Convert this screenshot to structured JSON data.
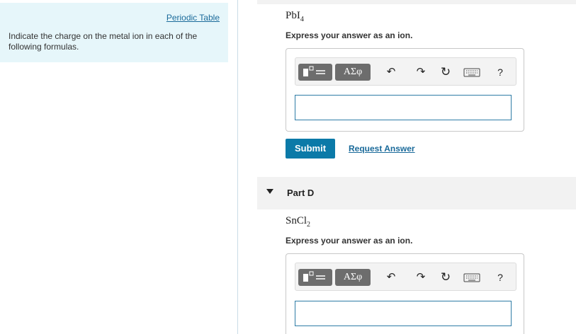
{
  "sidebar": {
    "periodic_table_link": "Periodic Table",
    "prompt": "Indicate the charge on the metal ion in each of the following formulas."
  },
  "part_c": {
    "formula_main": "PbI",
    "formula_sub": "4",
    "instruction": "Express your answer as an ion.",
    "toolbar": {
      "greek_label": "ΑΣφ",
      "undo_glyph": "↶",
      "redo_glyph": "↷",
      "reset_glyph": "↻",
      "help_label": "?"
    },
    "answer_value": "",
    "submit_label": "Submit",
    "request_answer_label": "Request Answer"
  },
  "part_d": {
    "label": "Part D",
    "formula_main": "SnCl",
    "formula_sub": "2",
    "instruction": "Express your answer as an ion.",
    "toolbar": {
      "greek_label": "ΑΣφ",
      "undo_glyph": "↶",
      "redo_glyph": "↷",
      "reset_glyph": "↻",
      "help_label": "?"
    },
    "answer_value": ""
  },
  "colors": {
    "sidebar_bg": "#e6f6fa",
    "link": "#1a6a9a",
    "submit_bg": "#0b7aa8",
    "toolbar_button": "#6d6d6d",
    "input_border": "#2e7ca6"
  }
}
